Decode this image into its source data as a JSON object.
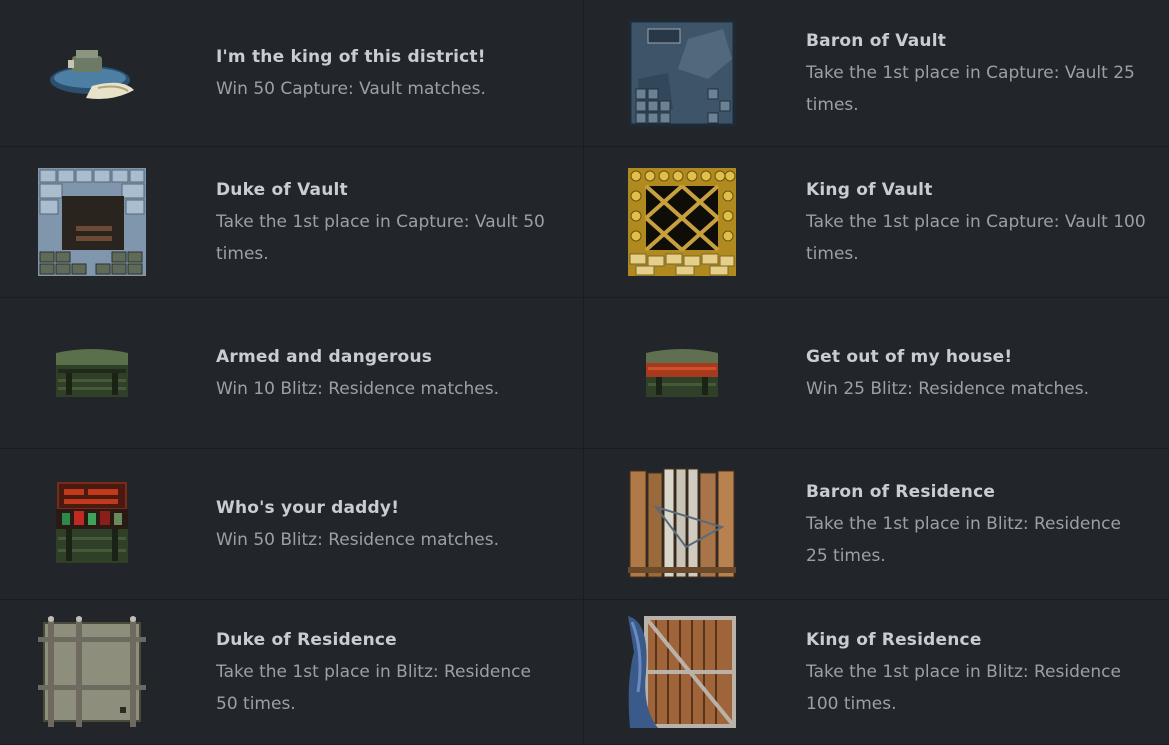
{
  "achievements": [
    {
      "title": "I'm the king of this district!",
      "description": "Win 50 Capture: Vault matches.",
      "icon": "hovercraft-icon"
    },
    {
      "title": "Baron of Vault",
      "description": "Take the 1st place in Capture: Vault 25 times.",
      "icon": "vault-stone-wall-icon"
    },
    {
      "title": "Duke of Vault",
      "description": "Take the 1st place in Capture: Vault 50 times.",
      "icon": "vault-brick-wall-icon"
    },
    {
      "title": "King of Vault",
      "description": "Take the 1st place in Capture: Vault 100 times.",
      "icon": "vault-gold-wall-icon"
    },
    {
      "title": "Armed and dangerous",
      "description": "Win 10 Blitz: Residence matches.",
      "icon": "closed-ammo-crate-icon"
    },
    {
      "title": "Get out of my house!",
      "description": "Win 25 Blitz: Residence matches.",
      "icon": "red-ammo-crate-icon"
    },
    {
      "title": "Who's your daddy!",
      "description": "Win 50 Blitz: Residence matches.",
      "icon": "open-ammo-crate-icon"
    },
    {
      "title": "Baron of Residence",
      "description": "Take the 1st place in Blitz: Residence 25 times.",
      "icon": "wooden-fence-icon"
    },
    {
      "title": "Duke of Residence",
      "description": "Take the 1st place in Blitz: Residence 50 times.",
      "icon": "metal-panel-icon"
    },
    {
      "title": "King of Residence",
      "description": "Take the 1st place in Blitz: Residence 100 times.",
      "icon": "wooden-door-curtain-icon"
    }
  ]
}
